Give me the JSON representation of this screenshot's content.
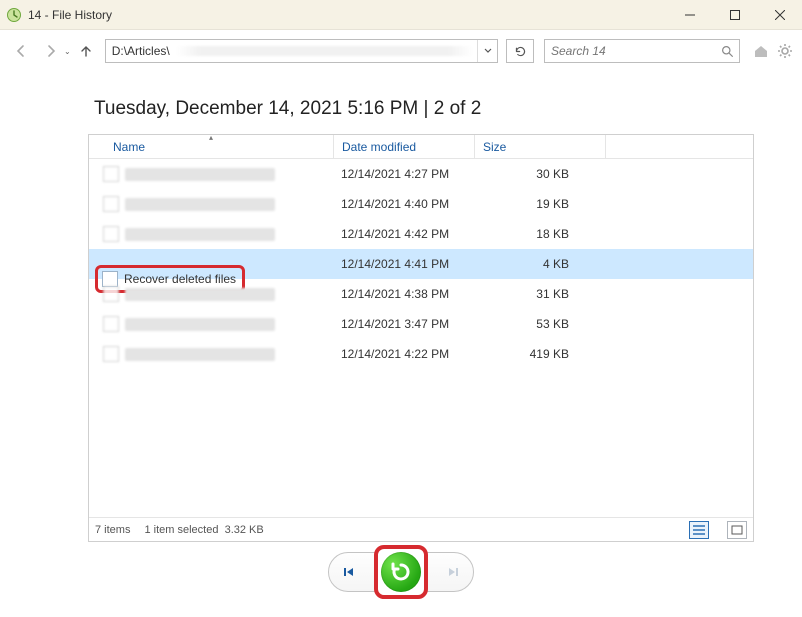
{
  "window": {
    "title": "14 - File History"
  },
  "nav": {
    "path": "D:\\Articles\\",
    "search_placeholder": "Search 14"
  },
  "heading": "Tuesday, December 14, 2021 5:16 PM   |   2 of 2",
  "columns": {
    "name": "Name",
    "date": "Date modified",
    "size": "Size"
  },
  "rows": [
    {
      "name": "",
      "date": "12/14/2021 4:27 PM",
      "size": "30 KB",
      "blurred": true
    },
    {
      "name": "",
      "date": "12/14/2021 4:40 PM",
      "size": "19 KB",
      "blurred": true
    },
    {
      "name": "",
      "date": "12/14/2021 4:42 PM",
      "size": "18 KB",
      "blurred": true
    },
    {
      "name": "Recover deleted files",
      "date": "12/14/2021 4:41 PM",
      "size": "4 KB",
      "blurred": false,
      "selected": true,
      "annot": true
    },
    {
      "name": "",
      "date": "12/14/2021 4:38 PM",
      "size": "31 KB",
      "blurred": true
    },
    {
      "name": "",
      "date": "12/14/2021 3:47 PM",
      "size": "53 KB",
      "blurred": true
    },
    {
      "name": "",
      "date": "12/14/2021 4:22 PM",
      "size": "419 KB",
      "blurred": true
    }
  ],
  "status": {
    "items": "7 items",
    "selected": "1 item selected",
    "size": "3.32 KB"
  }
}
